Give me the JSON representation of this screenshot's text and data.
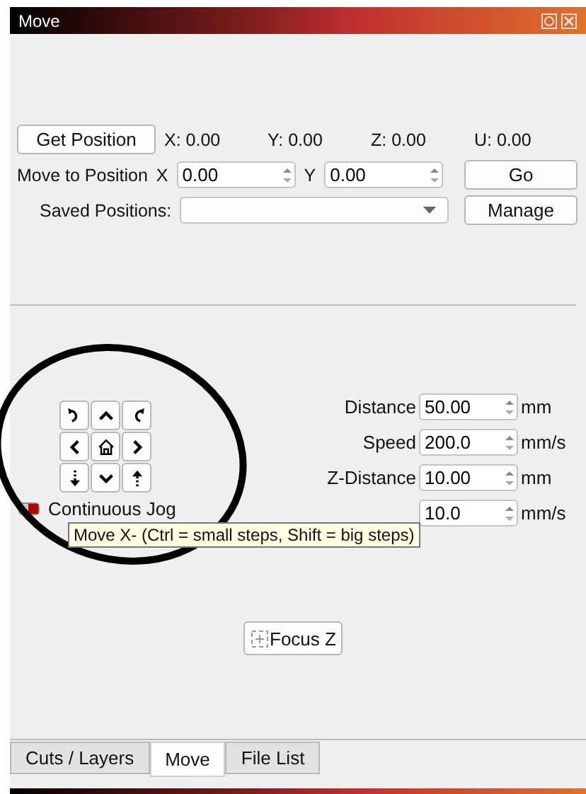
{
  "window": {
    "title": "Move"
  },
  "position": {
    "button": "Get Position",
    "readouts": [
      "X: 0.00",
      "Y: 0.00",
      "Z: 0.00",
      "U: 0.00"
    ]
  },
  "move_to": {
    "label": "Move to Position",
    "x_label": "X",
    "x_value": "0.00",
    "y_label": "Y",
    "y_value": "0.00",
    "button": "Go"
  },
  "saved": {
    "label": "Saved Positions:",
    "button": "Manage"
  },
  "jog": {
    "label": "Continuous Jog",
    "on": true
  },
  "settings": [
    {
      "label": "Distance",
      "value": "50.00",
      "unit": "mm"
    },
    {
      "label": "Speed",
      "value": "200.0",
      "unit": "mm/s"
    },
    {
      "label": "Z-Distance",
      "value": "10.00",
      "unit": "mm"
    },
    {
      "value": "10.0",
      "unit": "mm/s"
    }
  ],
  "tooltip": "Move X- (Ctrl = small steps, Shift = big steps)",
  "focus_button": "Focus Z",
  "tabs": [
    {
      "label": "Cuts / Layers",
      "selected": false
    },
    {
      "label": "Move",
      "selected": true
    },
    {
      "label": "File List",
      "selected": false
    }
  ]
}
